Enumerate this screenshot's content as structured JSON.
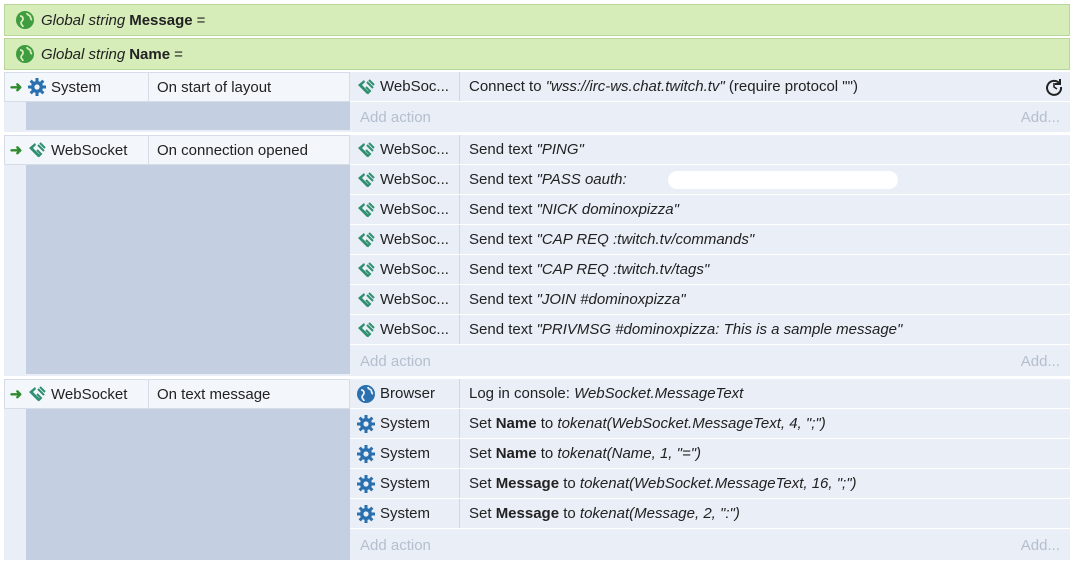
{
  "globals": [
    {
      "keyword": "Global string",
      "name": "Message",
      "eq": "="
    },
    {
      "keyword": "Global string",
      "name": "Name",
      "eq": "="
    }
  ],
  "add_action_label": "Add action",
  "add_ellipsis_label": "Add...",
  "events": [
    {
      "condition": {
        "object": "System",
        "icon": "gear-icon",
        "text": "On start of layout"
      },
      "actions": [
        {
          "object": "WebSoc...",
          "icon": "websocket-icon",
          "verb": "Connect to ",
          "arg": "\"wss://irc-ws.chat.twitch.tv\"",
          "rest": " (require protocol \"\")"
        }
      ]
    },
    {
      "condition": {
        "object": "WebSocket",
        "icon": "websocket-icon",
        "text": "On connection opened"
      },
      "actions": [
        {
          "object": "WebSoc...",
          "icon": "websocket-icon",
          "verb": "Send text ",
          "arg": "\"PING\""
        },
        {
          "object": "WebSoc...",
          "icon": "websocket-icon",
          "verb": "Send text ",
          "arg": "\"PASS oauth:"
        },
        {
          "object": "WebSoc...",
          "icon": "websocket-icon",
          "verb": "Send text ",
          "arg": "\"NICK dominoxpizza\""
        },
        {
          "object": "WebSoc...",
          "icon": "websocket-icon",
          "verb": "Send text ",
          "arg": "\"CAP REQ :twitch.tv/commands\""
        },
        {
          "object": "WebSoc...",
          "icon": "websocket-icon",
          "verb": "Send text ",
          "arg": "\"CAP REQ :twitch.tv/tags\""
        },
        {
          "object": "WebSoc...",
          "icon": "websocket-icon",
          "verb": "Send text ",
          "arg": "\"JOIN #dominoxpizza\""
        },
        {
          "object": "WebSoc...",
          "icon": "websocket-icon",
          "verb": "Send text ",
          "arg": "\"PRIVMSG #dominoxpizza: This is a sample message\""
        }
      ]
    },
    {
      "condition": {
        "object": "WebSocket",
        "icon": "websocket-icon",
        "text": "On text message"
      },
      "actions": [
        {
          "object": "Browser",
          "icon": "globe-icon",
          "verb": "Log in console: ",
          "arg": "WebSocket.MessageText"
        },
        {
          "object": "System",
          "icon": "gear-icon",
          "verb": "Set ",
          "var": "Name",
          "to": " to ",
          "arg": "tokenat(WebSocket.MessageText, 4, \";\")"
        },
        {
          "object": "System",
          "icon": "gear-icon",
          "verb": "Set ",
          "var": "Name",
          "to": " to ",
          "arg": "tokenat(Name, 1, \"=\")"
        },
        {
          "object": "System",
          "icon": "gear-icon",
          "verb": "Set ",
          "var": "Message",
          "to": " to ",
          "arg": "tokenat(WebSocket.MessageText, 16, \";\")"
        },
        {
          "object": "System",
          "icon": "gear-icon",
          "verb": "Set ",
          "var": "Message",
          "to": " to ",
          "arg": "tokenat(Message, 2, \":\")"
        }
      ]
    }
  ]
}
